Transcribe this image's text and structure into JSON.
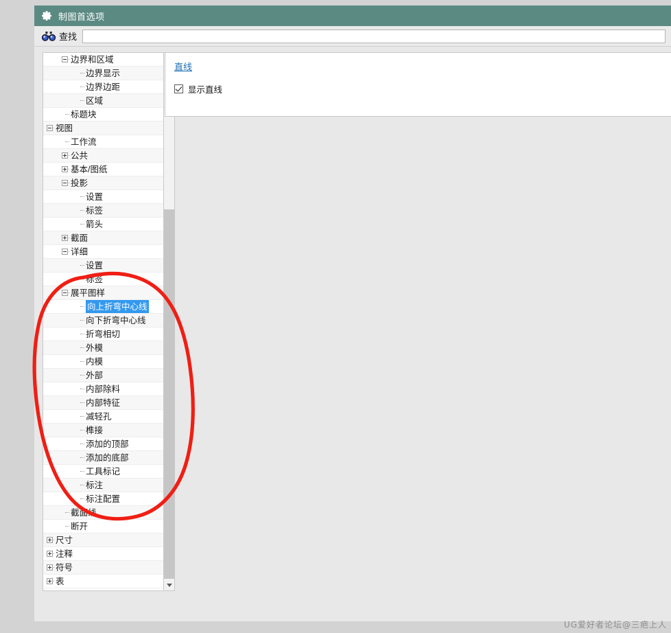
{
  "window": {
    "title": "制图首选项",
    "gear_icon": "gear-icon"
  },
  "toolbar": {
    "find_icon": "binoculars-icon",
    "find_label": "查找",
    "find_value": "",
    "find_placeholder": ""
  },
  "tree": {
    "items": [
      {
        "label": "边界和区域",
        "depth": 1,
        "state": "minus"
      },
      {
        "label": "边界显示",
        "depth": 2,
        "state": "none"
      },
      {
        "label": "边界边距",
        "depth": 2,
        "state": "none"
      },
      {
        "label": "区域",
        "depth": 2,
        "state": "none"
      },
      {
        "label": "标题块",
        "depth": 1,
        "state": "none"
      },
      {
        "label": "视图",
        "depth": 0,
        "state": "minus"
      },
      {
        "label": "工作流",
        "depth": 1,
        "state": "none"
      },
      {
        "label": "公共",
        "depth": 1,
        "state": "plus"
      },
      {
        "label": "基本/图纸",
        "depth": 1,
        "state": "plus"
      },
      {
        "label": "投影",
        "depth": 1,
        "state": "minus"
      },
      {
        "label": "设置",
        "depth": 2,
        "state": "none"
      },
      {
        "label": "标签",
        "depth": 2,
        "state": "none"
      },
      {
        "label": "箭头",
        "depth": 2,
        "state": "none"
      },
      {
        "label": "截面",
        "depth": 1,
        "state": "plus"
      },
      {
        "label": "详细",
        "depth": 1,
        "state": "minus"
      },
      {
        "label": "设置",
        "depth": 2,
        "state": "none"
      },
      {
        "label": "标签",
        "depth": 2,
        "state": "none"
      },
      {
        "label": "展平图样",
        "depth": 1,
        "state": "minus"
      },
      {
        "label": "向上折弯中心线",
        "depth": 2,
        "state": "none",
        "selected": true
      },
      {
        "label": "向下折弯中心线",
        "depth": 2,
        "state": "none"
      },
      {
        "label": "折弯相切",
        "depth": 2,
        "state": "none"
      },
      {
        "label": "外模",
        "depth": 2,
        "state": "none"
      },
      {
        "label": "内模",
        "depth": 2,
        "state": "none"
      },
      {
        "label": "外部",
        "depth": 2,
        "state": "none"
      },
      {
        "label": "内部除料",
        "depth": 2,
        "state": "none"
      },
      {
        "label": "内部特征",
        "depth": 2,
        "state": "none"
      },
      {
        "label": "减轻孔",
        "depth": 2,
        "state": "none"
      },
      {
        "label": "榫接",
        "depth": 2,
        "state": "none"
      },
      {
        "label": "添加的顶部",
        "depth": 2,
        "state": "none"
      },
      {
        "label": "添加的底部",
        "depth": 2,
        "state": "none"
      },
      {
        "label": "工具标记",
        "depth": 2,
        "state": "none"
      },
      {
        "label": "标注",
        "depth": 2,
        "state": "none"
      },
      {
        "label": "标注配置",
        "depth": 2,
        "state": "none"
      },
      {
        "label": "截面线",
        "depth": 1,
        "state": "none"
      },
      {
        "label": "断开",
        "depth": 1,
        "state": "none"
      },
      {
        "label": "尺寸",
        "depth": 0,
        "state": "plus"
      },
      {
        "label": "注释",
        "depth": 0,
        "state": "plus"
      },
      {
        "label": "符号",
        "depth": 0,
        "state": "plus"
      },
      {
        "label": "表",
        "depth": 0,
        "state": "plus"
      }
    ]
  },
  "scrollbar": {
    "up_icon": "chevron-up-icon",
    "down_icon": "chevron-down-icon"
  },
  "content": {
    "section_title": "直线",
    "checkbox_label": "显示直线",
    "checkbox_checked": true
  },
  "annotation": {
    "color": "#f01e14",
    "shape": "hand-drawn-ellipse"
  },
  "watermark": {
    "text": "UG爱好者论坛@三疤上人"
  },
  "colors": {
    "titlebar": "#5b8a83",
    "selection": "#3399ee",
    "section_link": "#1f6fb4",
    "desktop": "#d3d3d3"
  }
}
